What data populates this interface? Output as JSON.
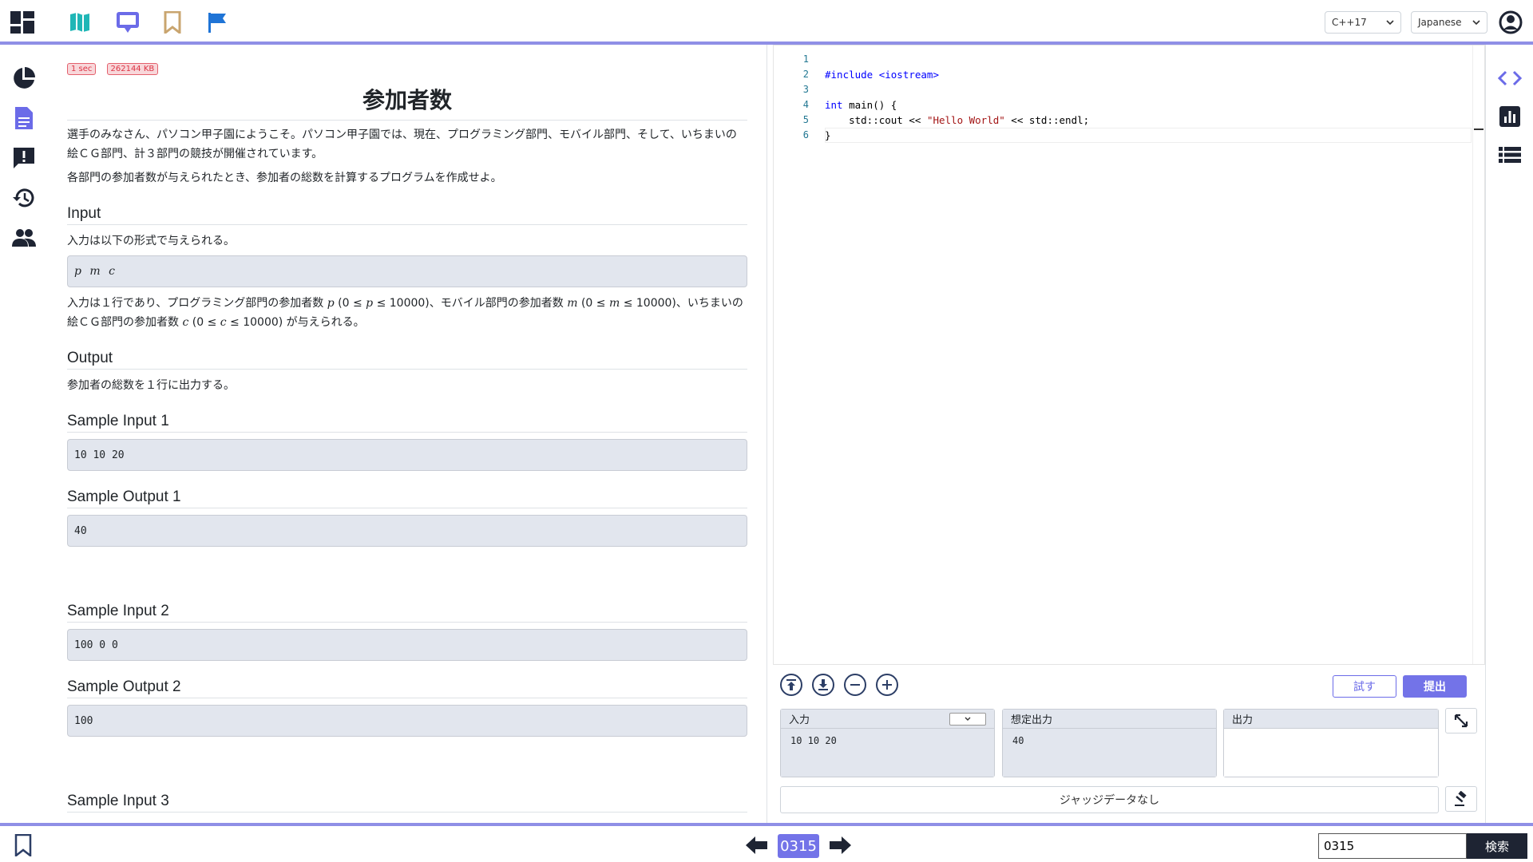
{
  "header": {
    "icons": [
      "dashboard-icon",
      "map-icon",
      "monitor-icon",
      "bookmark-icon",
      "flag-icon",
      "account-icon"
    ],
    "language_select": "C++17",
    "locale_select": "Japanese"
  },
  "left_nav": {
    "icons": [
      "pie-chart-icon",
      "document-icon",
      "feedback-icon",
      "history-icon",
      "users-icon"
    ]
  },
  "right_nav": {
    "icons": [
      "code-icon",
      "bar-chart-icon",
      "list-icon"
    ]
  },
  "problem": {
    "time_limit": "1 sec",
    "memory_limit": "262144 KB",
    "title": "参加者数",
    "statement_1": "選手のみなさん、パソコン甲子園にようこそ。パソコン甲子園では、現在、プログラミング部門、モバイル部門、そして、いちまいの絵ＣＧ部門、計３部門の競技が開催されています。",
    "statement_2": "各部門の参加者数が与えられたとき、参加者の総数を計算するプログラムを作成せよ。",
    "input_heading": "Input",
    "input_intro": "入力は以下の形式で与えられる。",
    "input_format": "p m c",
    "input_desc_a": "入力は１行であり、プログラミング部門の参加者数 ",
    "input_desc_p": "p",
    "input_desc_b": " (0 ≤ ",
    "input_desc_p2": "p",
    "input_desc_c": " ≤ 10000)、モバイル部門の参加者数 ",
    "input_desc_m": "m",
    "input_desc_d": " (0 ≤ ",
    "input_desc_m2": "m",
    "input_desc_e": " ≤ 10000)、いちまいの絵ＣＧ部門の参加者数 ",
    "input_desc_cv": "c",
    "input_desc_f": " (0 ≤ ",
    "input_desc_c2": "c",
    "input_desc_g": " ≤ 10000) が与えられる。",
    "output_heading": "Output",
    "output_desc": "参加者の総数を１行に出力する。",
    "samples": [
      {
        "in_heading": "Sample Input 1",
        "in": "10 10 20",
        "out_heading": "Sample Output 1",
        "out": "40"
      },
      {
        "in_heading": "Sample Input 2",
        "in": "100 0 0",
        "out_heading": "Sample Output 2",
        "out": "100"
      }
    ],
    "next_heading": "Sample Input 3"
  },
  "editor": {
    "line_numbers": [
      "1",
      "2",
      "3",
      "4",
      "5",
      "6"
    ],
    "code": {
      "l1": "#include <iostream>",
      "l3_kw": "int",
      "l3_rest": " main() {",
      "l4_a": "    std::cout << ",
      "l4_str": "\"Hello World\"",
      "l4_b": " << std::endl;",
      "l5": "}"
    }
  },
  "toolbar": {
    "try_label": "試す",
    "submit_label": "提出"
  },
  "io": {
    "input_label": "入力",
    "input_value": "10 10 20",
    "expected_label": "想定出力",
    "expected_value": "40",
    "output_label": "出力",
    "output_value": ""
  },
  "judge": {
    "status": "ジャッジデータなし"
  },
  "footer": {
    "problem_id": "0315",
    "search_value": "0315",
    "search_label": "検索"
  }
}
